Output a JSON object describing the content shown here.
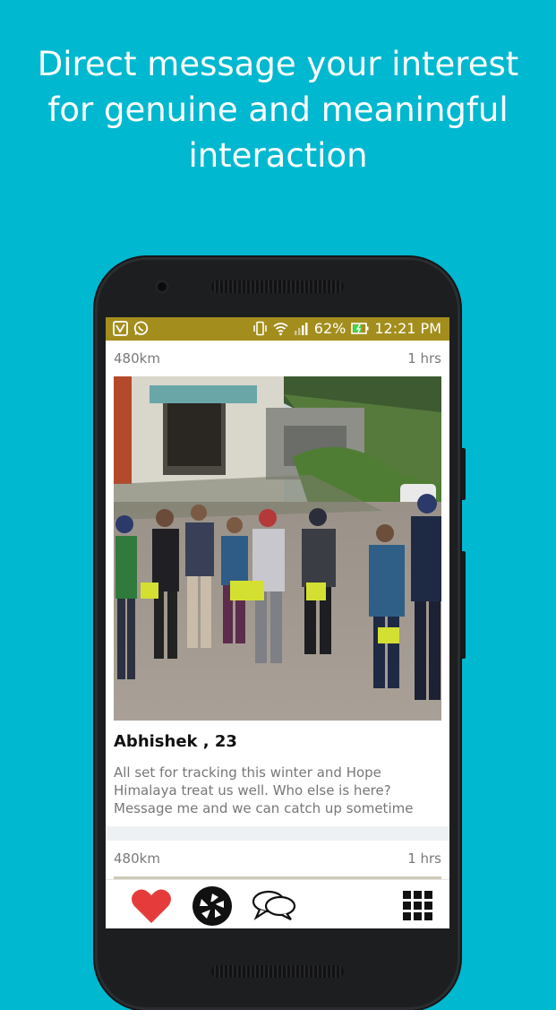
{
  "promo": {
    "line1": "Direct message your interest",
    "line2": "for genuine and meaningful",
    "line3": "interaction"
  },
  "status_bar": {
    "battery_percent": "62%",
    "time": "12:21 PM",
    "icons": [
      "app-icon",
      "whatsapp-icon",
      "vibrate-icon",
      "wifi-icon",
      "signal-icon",
      "battery-icon"
    ]
  },
  "feed": {
    "posts": [
      {
        "distance": "480km",
        "time_ago": "1 hrs",
        "author": "Abhishek , 23",
        "caption": "All set for tracking this winter and Hope Himalaya treat us well. Who else is here? Message me and we can catch up sometime"
      },
      {
        "distance": "480km",
        "time_ago": "1 hrs"
      }
    ]
  },
  "bottom_nav": {
    "items": [
      "heart-icon",
      "camera-shutter-icon",
      "chat-icon",
      "grid-icon"
    ],
    "colors": {
      "heart": "#e53b3b",
      "shutter": "#111111"
    }
  },
  "colors": {
    "background": "#00b8d0",
    "status_bar": "#a38d1c"
  }
}
